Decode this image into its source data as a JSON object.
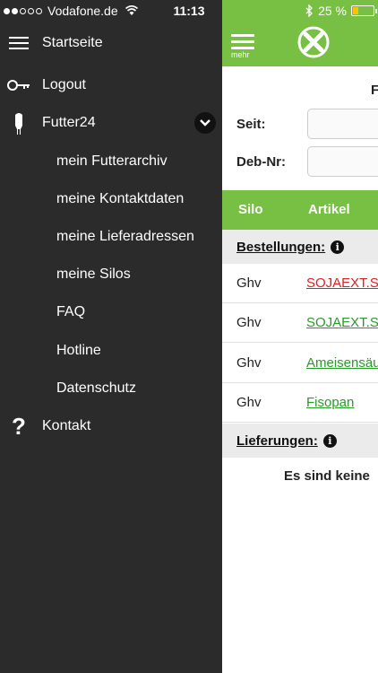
{
  "status_bar": {
    "carrier": "Vodafone.de",
    "time": "11:13",
    "battery": "25 %",
    "battery_level": 0.25,
    "signal_bars": 2
  },
  "side_menu": {
    "items": [
      {
        "label": "Startseite",
        "icon": "hamburger-icon"
      },
      {
        "label": "Logout",
        "icon": "key-icon"
      },
      {
        "label": "Futter24",
        "icon": "silo-icon"
      },
      {
        "label": "mein Futterarchiv"
      },
      {
        "label": "meine Kontaktdaten"
      },
      {
        "label": "meine Lieferadressen"
      },
      {
        "label": "meine Silos"
      },
      {
        "label": "FAQ"
      },
      {
        "label": "Hotline"
      },
      {
        "label": "Datenschutz"
      },
      {
        "label": "Kontakt",
        "icon": "question-icon"
      }
    ]
  },
  "main": {
    "menu_label": "mehr",
    "form_title_fragment": "F",
    "seit_label": "Seit:",
    "deb_label": "Deb-Nr:",
    "columns": [
      "Silo",
      "Artikel"
    ],
    "bestellungen_label": "Bestellungen:",
    "lieferungen_label": "Lieferungen:",
    "orders": [
      {
        "silo": "Ghv",
        "artikel": "SOJAEXT.S"
      },
      {
        "silo": "Ghv",
        "artikel": "SOJAEXT.S"
      },
      {
        "silo": "Ghv",
        "artikel": "Ameisensäu"
      },
      {
        "silo": "Ghv",
        "artikel": "Fisopan"
      }
    ],
    "no_data_text": "Es sind keine",
    "colors": {
      "accent": "#77c043",
      "menu_bg": "#2b2b2b",
      "link_red": "#e02020",
      "link_green": "#2a9a2a"
    }
  }
}
